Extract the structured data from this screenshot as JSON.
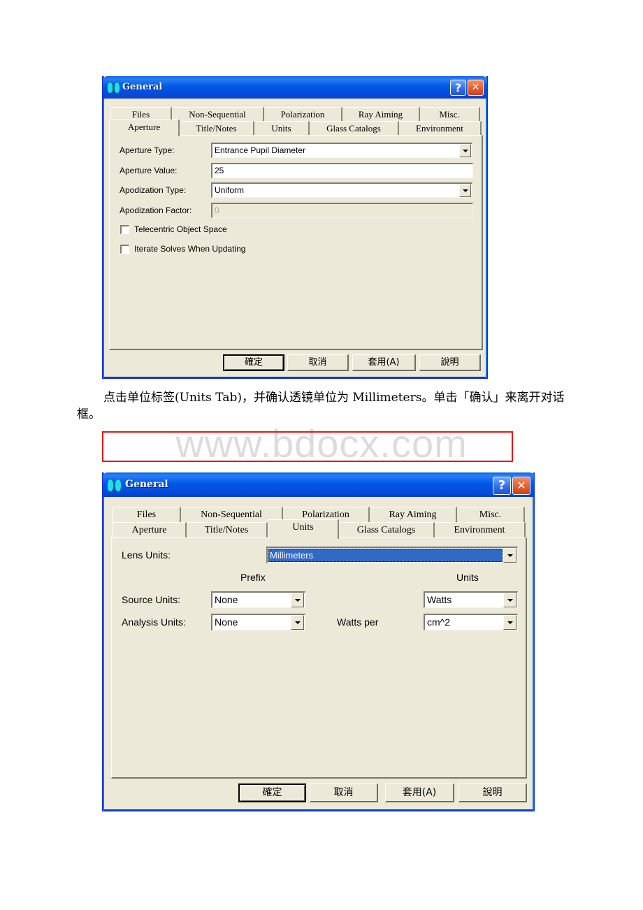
{
  "dialog1": {
    "title": "General",
    "help_label": "?",
    "close_label": "✕",
    "tabs_back": [
      "Files",
      "Non-Sequential",
      "Polarization",
      "Ray Aiming",
      "Misc."
    ],
    "tabs_front": [
      "Aperture",
      "Title/Notes",
      "Units",
      "Glass Catalogs",
      "Environment"
    ],
    "active_tab": "Aperture",
    "fields": {
      "aperture_type_label": "Aperture Type:",
      "aperture_type_value": "Entrance Pupil Diameter",
      "aperture_value_label": "Aperture Value:",
      "aperture_value_value": "25",
      "apodization_type_label": "Apodization Type:",
      "apodization_type_value": "Uniform",
      "apodization_factor_label": "Apodization Factor:",
      "apodization_factor_value": "0"
    },
    "checkboxes": [
      {
        "label": "Telecentric Object Space",
        "checked": false
      },
      {
        "label": "Iterate Solves When Updating",
        "checked": false
      }
    ],
    "buttons": {
      "ok": "確定",
      "cancel": "取消",
      "apply": "套用(A)",
      "help": "說明"
    }
  },
  "caption": {
    "text": "点击单位标签(Units Tab)，并确认透镜单位为 Millimeters。单击「确认」来离开对话框。"
  },
  "watermark": {
    "text": "www.bdocx.com"
  },
  "dialog2": {
    "title": "General",
    "help_label": "?",
    "close_label": "✕",
    "tabs_back": [
      "Files",
      "Non-Sequential",
      "Polarization",
      "Ray Aiming",
      "Misc."
    ],
    "tabs_front": [
      "Aperture",
      "Title/Notes",
      "Units",
      "Glass Catalogs",
      "Environment"
    ],
    "active_tab": "Units",
    "lens_units_label": "Lens Units:",
    "lens_units_value": "Millimeters",
    "prefix_header": "Prefix",
    "units_header": "Units",
    "source_units_label": "Source Units:",
    "source_prefix_value": "None",
    "source_units_value": "Watts",
    "analysis_units_label": "Analysis Units:",
    "analysis_prefix_value": "None",
    "watts_per_label": "Watts per",
    "analysis_units_value": "cm^2",
    "buttons": {
      "ok": "確定",
      "cancel": "取消",
      "apply": "套用(A)",
      "help": "說明"
    }
  }
}
